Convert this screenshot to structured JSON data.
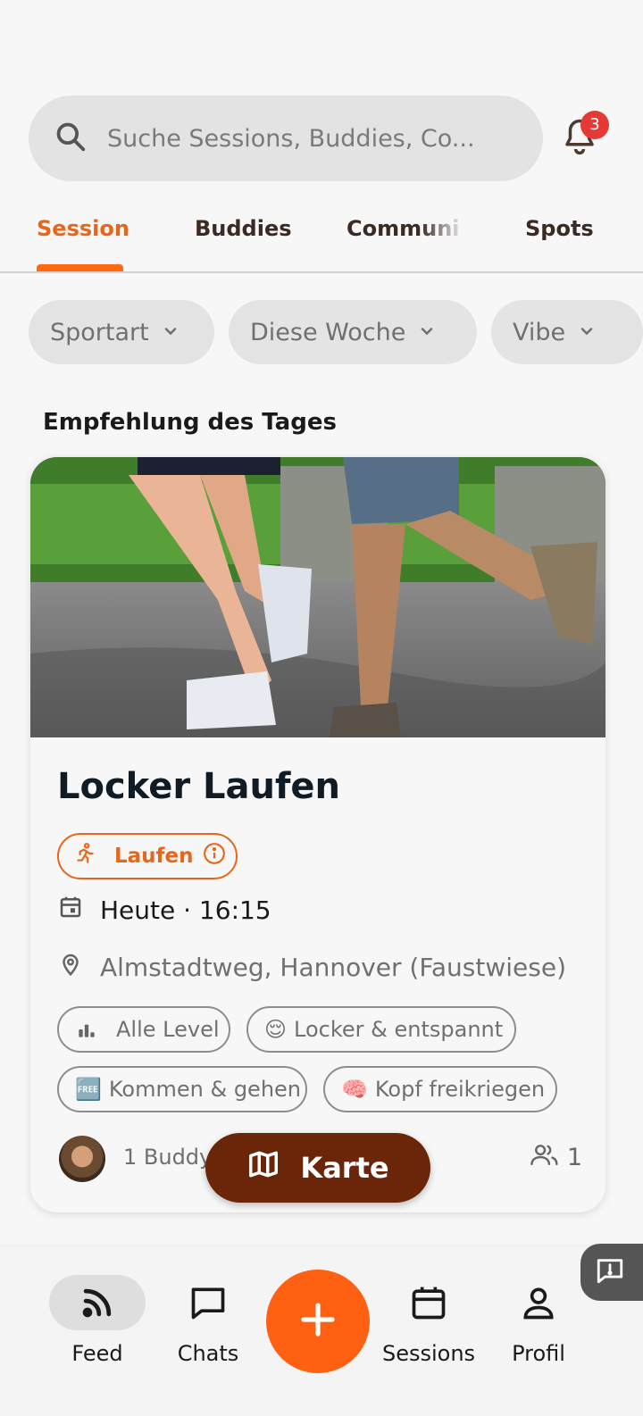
{
  "search": {
    "placeholder": "Suche Sessions, Buddies, Co..."
  },
  "notifications": {
    "count": "3",
    "icon": "bell-icon"
  },
  "tabs": [
    {
      "label": "Session",
      "active": true
    },
    {
      "label": "Buddies",
      "active": false
    },
    {
      "label": "Communi",
      "active": false
    },
    {
      "label": "Spots",
      "active": false
    }
  ],
  "filters": [
    {
      "label": "Sportart"
    },
    {
      "label": "Diese Woche"
    },
    {
      "label": "Vibe"
    }
  ],
  "section": {
    "title": "Empfehlung des Tages"
  },
  "card": {
    "title": "Locker Laufen",
    "sport": "Laufen",
    "datetime": "Heute · 16:15",
    "location": "Almstadtweg, Hannover (Faustwiese)",
    "tags": [
      {
        "emoji": "",
        "label": "Alle Level"
      },
      {
        "emoji": "😌",
        "label": "Locker & entspannt"
      },
      {
        "emoji": "🆓",
        "label": "Kommen & gehen"
      },
      {
        "emoji": "🧠",
        "label": "Kopf freikriegen"
      }
    ],
    "buddy_text": "1 Buddy",
    "participants": "1"
  },
  "map_button": {
    "label": "Karte"
  },
  "nav": [
    {
      "label": "Feed",
      "icon": "rss-icon",
      "active": true
    },
    {
      "label": "Chats",
      "icon": "chat-icon",
      "active": false
    },
    {
      "label": "Sessions",
      "icon": "calendar-icon",
      "active": false
    },
    {
      "label": "Profil",
      "icon": "person-icon",
      "active": false
    }
  ],
  "colors": {
    "accent": "#ff6a13",
    "map_button": "#6b2508",
    "badge": "#e53935"
  }
}
